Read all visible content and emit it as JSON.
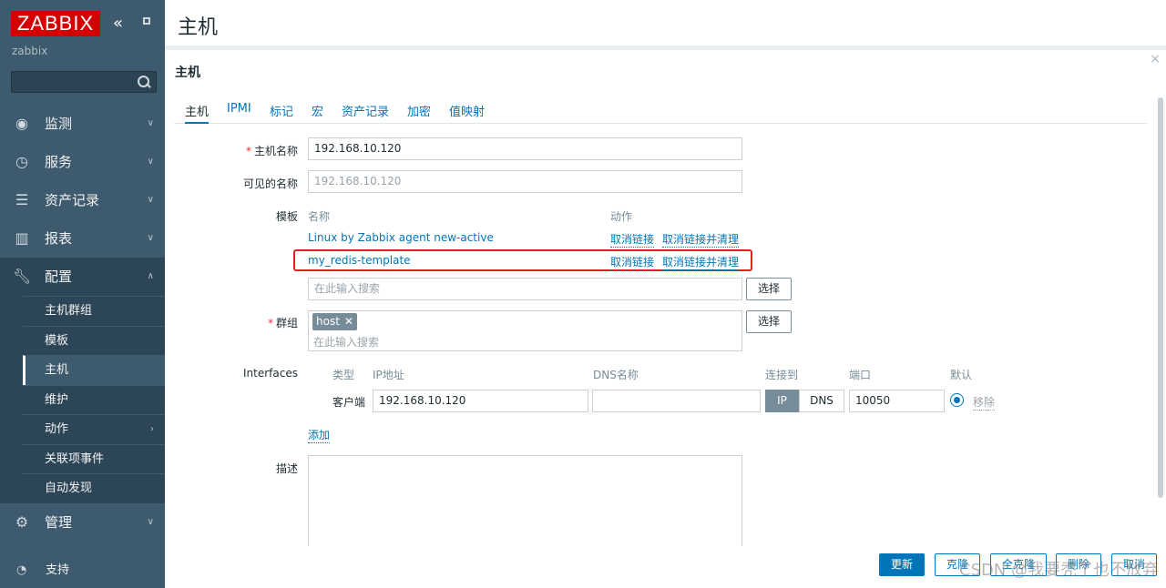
{
  "sidebar": {
    "logo": "ZABBIX",
    "collapse_glyph": "«",
    "server_name": "zabbix",
    "search_value": "",
    "menu": [
      {
        "label": "监测",
        "icon": "eye-icon"
      },
      {
        "label": "服务",
        "icon": "stopwatch-icon"
      },
      {
        "label": "资产记录",
        "icon": "list-icon"
      },
      {
        "label": "报表",
        "icon": "bar-chart-icon"
      },
      {
        "label": "配置",
        "icon": "wrench-icon"
      }
    ],
    "submenu": [
      "主机群组",
      "模板",
      "主机",
      "维护",
      "动作",
      "关联项事件",
      "自动发现"
    ],
    "admin": "管理",
    "support": "支持"
  },
  "header": {
    "title": "主机"
  },
  "modal": {
    "title": "主机",
    "close": "×",
    "tabs": [
      "主机",
      "IPMI",
      "标记",
      "宏",
      "资产记录",
      "加密",
      "值映射"
    ],
    "hostname_label": "主机名称",
    "hostname_value": "192.168.10.120",
    "visible_label": "可见的名称",
    "visible_placeholder": "192.168.10.120",
    "templates_label": "模板",
    "templates_col_name": "名称",
    "templates_col_action": "动作",
    "templates": [
      {
        "name": "Linux by Zabbix agent new-active",
        "unlink": "取消链接",
        "unlink_clear": "取消链接并清理"
      },
      {
        "name": "my_redis-template",
        "unlink": "取消链接",
        "unlink_clear": "取消链接并清理"
      }
    ],
    "template_search_placeholder": "在此输入搜索",
    "select_btn": "选择",
    "groups_label": "群组",
    "group_tag": "host",
    "group_search_placeholder": "在此输入搜索",
    "interfaces_label": "Interfaces",
    "iface_cols": {
      "type": "类型",
      "ip": "IP地址",
      "dns": "DNS名称",
      "connect": "连接到",
      "port": "端口",
      "default": "默认"
    },
    "iface": {
      "type": "客户端",
      "ip": "192.168.10.120",
      "dns": "",
      "ip_btn": "IP",
      "dns_btn": "DNS",
      "port": "10050",
      "remove": "移除"
    },
    "add_link": "添加",
    "desc_label": "描述",
    "footer": {
      "update": "更新",
      "clone": "克隆",
      "full_clone": "全克隆",
      "delete": "删除",
      "cancel": "取消"
    },
    "watermark": "CSDN @我要秃了也不放弃"
  }
}
